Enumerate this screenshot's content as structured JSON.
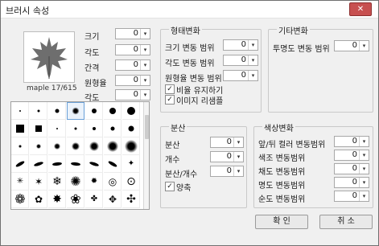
{
  "window": {
    "title": "브러시 속성",
    "close_label": "✕"
  },
  "preview": {
    "caption": "maple 17/615",
    "icon": "maple-leaf-icon"
  },
  "left": {
    "size_label": "크기",
    "size_value": "0",
    "angle_label": "각도",
    "angle_value": "0",
    "spacing_label": "간격",
    "spacing_value": "0",
    "roundness_label": "원형율",
    "roundness_value": "0",
    "angle2_label": "각도",
    "angle2_value": "0"
  },
  "shape": {
    "title": "형태변화",
    "size_var_label": "크기 변동 범위",
    "size_var_value": "0",
    "angle_var_label": "각도 변동 범위",
    "angle_var_value": "0",
    "round_var_label": "원형율 변동 범위",
    "round_var_value": "0",
    "keep_ratio_label": "비율 유지하기",
    "resample_label": "이미지 리샘플"
  },
  "other": {
    "title": "기타변화",
    "opacity_label": "투명도 변동 범위",
    "opacity_value": "0"
  },
  "scatter": {
    "title": "분산",
    "scatter_label": "분산",
    "scatter_value": "0",
    "count_label": "개수",
    "count_value": "0",
    "ratio_label": "분산/개수",
    "ratio_value": "0",
    "both_label": "양축"
  },
  "color": {
    "title": "색상변화",
    "fg_bg_label": "앞/뒤 컬러 변동범위",
    "fg_bg_value": "0",
    "hue_label": "색조 변동범위",
    "hue_value": "0",
    "sat_label": "채도 변동범위",
    "sat_value": "0",
    "bright_label": "명도 변동범위",
    "bright_value": "0",
    "purity_label": "순도 변동범위",
    "purity_value": "0"
  },
  "buttons": {
    "ok": "확 인",
    "cancel": "취 소"
  },
  "checks": {
    "mark": "✓"
  },
  "arrow": "▾",
  "brush_grid_glyphs": [
    "✳",
    "✶",
    "❄",
    "✺",
    "✹",
    "◎",
    "⊙",
    "❁",
    "✦",
    "✿",
    "✸",
    "❀",
    "✤",
    "✥",
    "✣",
    "✢"
  ]
}
